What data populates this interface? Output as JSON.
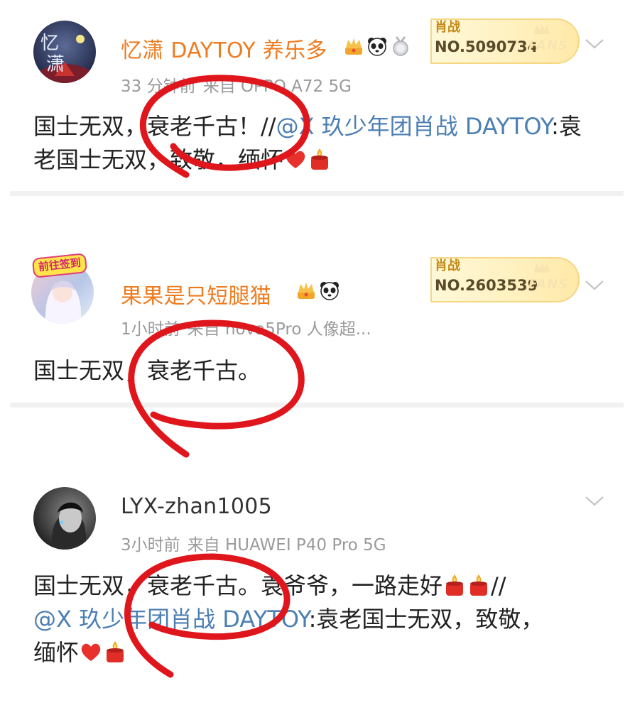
{
  "posts": [
    {
      "username": "忆潇 DAYTOY 养乐多",
      "fans_idol": "肖战",
      "fans_no": "NO.5090734",
      "fans_word": "FANS",
      "meta_time": "33 分钟前",
      "meta_source": "来自 OPPO A72 5G",
      "text_1": "国士无双，衰老千古！//",
      "mention": "@X 玖少年团肖战 DAYTOY",
      "text_2": ":袁老国士无双，致敬，缅怀",
      "icons": [
        "crown-icon",
        "panda-icon",
        "medal-icon",
        "heart-icon",
        "candle-icon"
      ]
    },
    {
      "username": "果果是只短腿猫",
      "avatar_tag": "前往签到",
      "fans_idol": "肖战",
      "fans_no": "NO.2603539",
      "fans_word": "FANS",
      "meta_time": "1小时前",
      "meta_source": "来自 nova5Pro 人像超...",
      "text_1": "国士无双，衰老千古。",
      "icons": [
        "crown-icon",
        "panda-icon"
      ]
    },
    {
      "username": "LYX-zhan1005",
      "meta_time": "3小时前",
      "meta_source": "来自 HUAWEI P40 Pro 5G",
      "text_1": "国士无双，衰老千古。袁爷爷，一路走好",
      "text_sep": "//",
      "mention": "@X 玖少年团肖战 DAYTOY",
      "text_2": ":袁老国士无双，致敬，",
      "text_3": "缅怀",
      "icons": [
        "candle-icon",
        "heart-icon"
      ]
    }
  ],
  "colors": {
    "username": "#ef7b1f",
    "mention": "#4c7fb3",
    "meta": "#9a9a9a",
    "marker": "#e0161d"
  }
}
